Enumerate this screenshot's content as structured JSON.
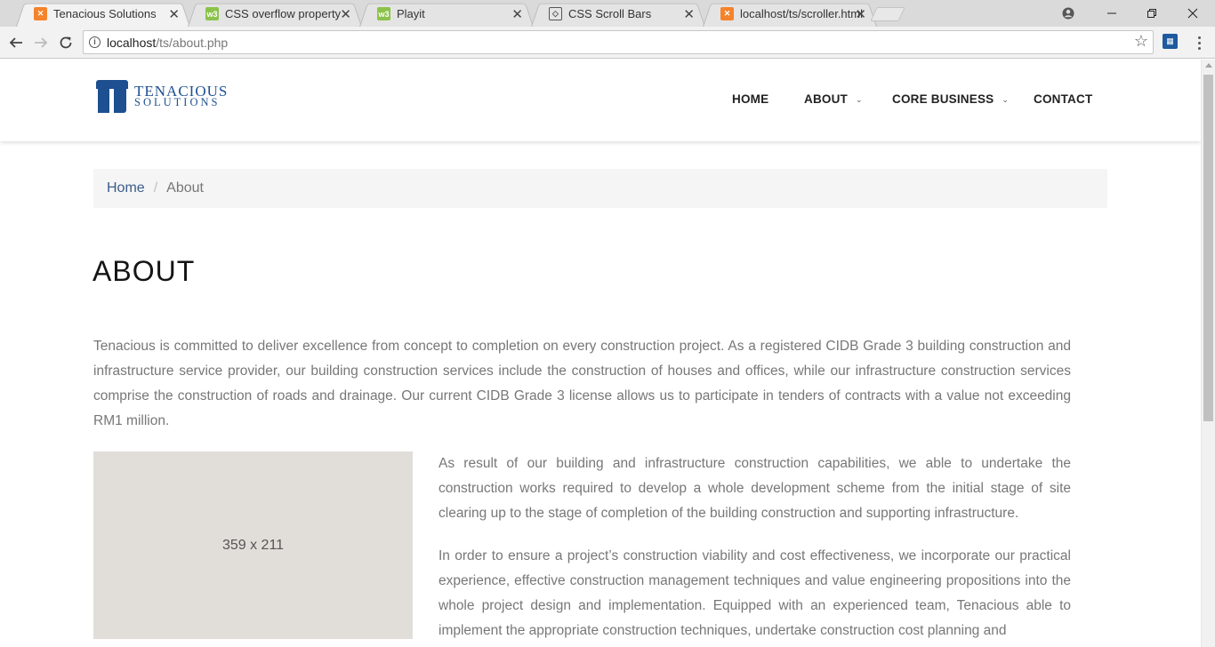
{
  "browser": {
    "tabs": [
      {
        "title": "Tenacious Solutions",
        "favicon": "xampp-icon",
        "active": true
      },
      {
        "title": "CSS overflow property",
        "favicon": "w3schools-icon",
        "active": false
      },
      {
        "title": "Playit",
        "favicon": "w3schools-icon",
        "active": false
      },
      {
        "title": "CSS Scroll Bars",
        "favicon": "codepen-icon",
        "active": false
      },
      {
        "title": "localhost/ts/scroller.html",
        "favicon": "xampp-icon",
        "active": false
      }
    ],
    "url_host": "localhost",
    "url_path": "/ts/about.php"
  },
  "site": {
    "logo": {
      "line1": "TENACIOUS",
      "line2": "SOLUTIONS",
      "color": "#1d4f91"
    },
    "nav": {
      "home": "HOME",
      "about": "ABOUT",
      "core_business": "CORE BUSINESS",
      "contact": "CONTACT"
    },
    "breadcrumb": {
      "home": "Home",
      "separator": "/",
      "current": "About"
    },
    "title": "ABOUT",
    "intro": "Tenacious is committed to deliver excellence from concept to completion on every construction project. As a registered CIDB Grade 3 building construction and infrastructure service provider, our building construction services include the construction of houses and offices, while our infrastructure construction services comprise the construction of roads and drainage. Our current CIDB Grade 3 license allows us to participate in tenders of contracts with a value not exceeding RM1 million.",
    "image_placeholder": "359 x 211",
    "paragraph1": "As result of our building and infrastructure construction capabilities, we able to undertake the construction works required to develop a whole development scheme from the initial stage of site clearing up to the stage of completion of the building construction and supporting infrastructure.",
    "paragraph2": "In order to ensure a project’s construction viability and cost effectiveness, we incorporate our practical experience, effective construction management techniques and value engineering propositions into the whole project design and implementation. Equipped with an experienced team, Tenacious able to implement the appropriate construction techniques, undertake construction cost planning and"
  }
}
